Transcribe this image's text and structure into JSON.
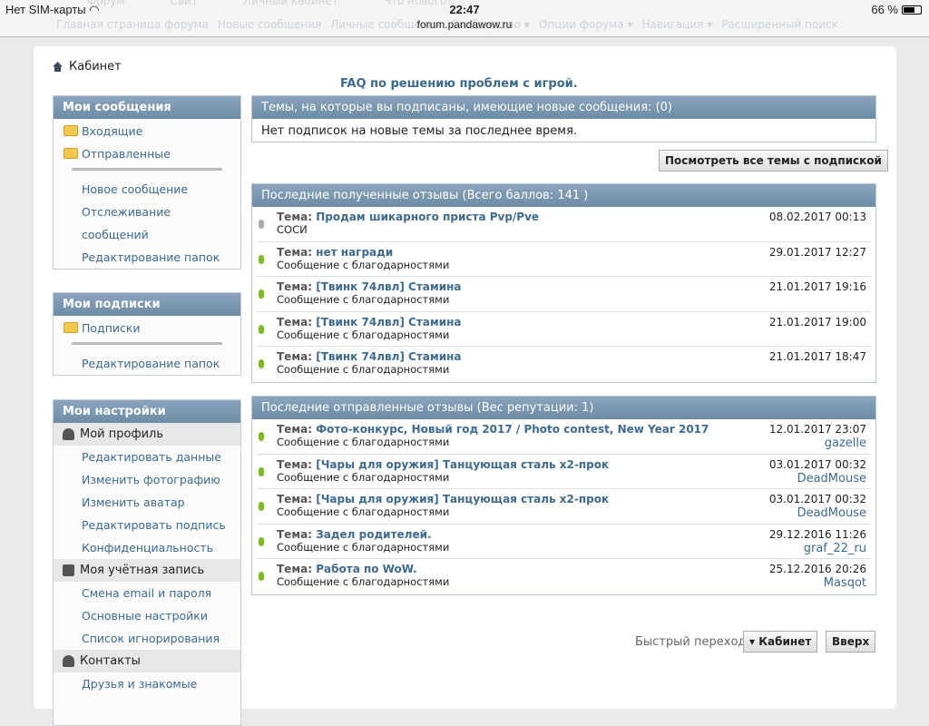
{
  "status_bar": {
    "carrier": "Нет SIM-карты",
    "time": "22:47",
    "url": "forum.pandawow.ru",
    "battery": "66 %",
    "battery_level": 0.66
  },
  "ghost_nav": {
    "top": [
      "Форум",
      "Сайт",
      "Личный кабинет",
      "Что нового?"
    ],
    "links": [
      "Главная страница форума",
      "Новые сообщения",
      "Личные сообщения",
      "Сообщество ▾",
      "Опции форума ▾",
      "Навигация ▾",
      "Расширенный поиск"
    ]
  },
  "breadcrumb": "Кабинет",
  "faq": "FAQ по решению проблем с игрой.",
  "sidebar": {
    "messages": {
      "title": "Мои сообщения",
      "folders": [
        "Входящие",
        "Отправленные"
      ],
      "links": [
        "Новое сообщение",
        "Отслеживание",
        "сообщений",
        "Редактирование папок"
      ]
    },
    "subs": {
      "title": "Мои подписки",
      "folders": [
        "Подписки"
      ],
      "links": [
        "Редактирование папок"
      ]
    },
    "settings": {
      "title": "Мои настройки",
      "profile": "Мой профиль",
      "profile_links": [
        "Редактировать данные",
        "Изменить фотографию",
        "Изменить аватар",
        "Редактировать подпись",
        "Конфиденциальность"
      ],
      "account": "Моя учётная запись",
      "account_links": [
        "Смена email и пароля",
        "Основные настройки",
        "Список игнорирования"
      ],
      "contacts": "Контакты",
      "contacts_links": [
        "Друзья и знакомые"
      ]
    }
  },
  "subscriptions": {
    "title": "Темы, на которые вы подписаны, имеющие новые сообщения: (0)",
    "empty": "Нет подписок на новые темы за последнее время.",
    "button": "Посмотреть все темы с подпиской"
  },
  "topic_label": "Тема:",
  "received": {
    "title": "Последние полученные отзывы (Всего баллов: 141 )",
    "items": [
      {
        "topic": "Продам шикарного приста Pvp/Pve",
        "text": "СОСИ",
        "date": "08.02.2017 00:13",
        "status": "neutral"
      },
      {
        "topic": "нет награди",
        "text": "Сообщение с благодарностями",
        "date": "29.01.2017 12:27",
        "status": "positive"
      },
      {
        "topic": "[Твинк 74лвл] Стамина",
        "text": "Сообщение с благодарностями",
        "date": "21.01.2017 19:16",
        "status": "positive"
      },
      {
        "topic": "[Твинк 74лвл] Стамина",
        "text": "Сообщение с благодарностями",
        "date": "21.01.2017 19:00",
        "status": "positive"
      },
      {
        "topic": "[Твинк 74лвл] Стамина",
        "text": "Сообщение с благодарностями",
        "date": "21.01.2017 18:47",
        "status": "positive"
      }
    ]
  },
  "sent": {
    "title": "Последние отправленные отзывы (Вес репутации: 1)",
    "items": [
      {
        "topic": "Фото-конкурс, Новый год 2017 / Photo contest, New Year 2017",
        "text": "Сообщение с благодарностями",
        "date": "12.01.2017 23:07",
        "user": "gazelle"
      },
      {
        "topic": "[Чары для оружия] Танцующая сталь x2-прок",
        "text": "Сообщение с благодарностями",
        "date": "03.01.2017 00:32",
        "user": "DeadMouse"
      },
      {
        "topic": "[Чары для оружия] Танцующая сталь x2-прок",
        "text": "Сообщение с благодарностями",
        "date": "03.01.2017 00:32",
        "user": "DeadMouse"
      },
      {
        "topic": "Задел родителей.",
        "text": "Сообщение с благодарностями",
        "date": "29.12.2016 11:26",
        "user": "graf_22_ru"
      },
      {
        "topic": "Работа по WoW.",
        "text": "Сообщение с благодарностями",
        "date": "25.12.2016 20:26",
        "user": "Masqot"
      }
    ]
  },
  "footer": {
    "quick_label": "Быстрый переход",
    "quick_button": "Кабинет",
    "top_button": "Вверх"
  }
}
